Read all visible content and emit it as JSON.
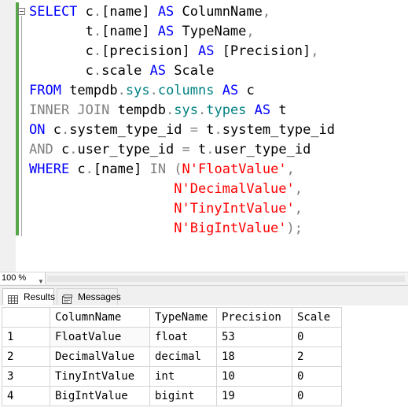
{
  "query_lines": [
    [
      {
        "t": "SELECT ",
        "c": "kw"
      },
      {
        "t": "c",
        "c": "plain"
      },
      {
        "t": ".",
        "c": "gr"
      },
      {
        "t": "[name] ",
        "c": "plain"
      },
      {
        "t": "AS ",
        "c": "kw"
      },
      {
        "t": "ColumnName",
        "c": "plain"
      },
      {
        "t": ",",
        "c": "gr"
      }
    ],
    [
      {
        "t": "       t",
        "c": "plain"
      },
      {
        "t": ".",
        "c": "gr"
      },
      {
        "t": "[name] ",
        "c": "plain"
      },
      {
        "t": "AS ",
        "c": "kw"
      },
      {
        "t": "TypeName",
        "c": "plain"
      },
      {
        "t": ",",
        "c": "gr"
      }
    ],
    [
      {
        "t": "       c",
        "c": "plain"
      },
      {
        "t": ".",
        "c": "gr"
      },
      {
        "t": "[precision] ",
        "c": "plain"
      },
      {
        "t": "AS ",
        "c": "kw"
      },
      {
        "t": "[Precision]",
        "c": "plain"
      },
      {
        "t": ",",
        "c": "gr"
      }
    ],
    [
      {
        "t": "       c",
        "c": "plain"
      },
      {
        "t": ".",
        "c": "gr"
      },
      {
        "t": "scale ",
        "c": "plain"
      },
      {
        "t": "AS ",
        "c": "kw"
      },
      {
        "t": "Scale",
        "c": "plain"
      }
    ],
    [
      {
        "t": "FROM ",
        "c": "kw"
      },
      {
        "t": "tempdb",
        "c": "plain"
      },
      {
        "t": ".",
        "c": "gr"
      },
      {
        "t": "sys",
        "c": "fn"
      },
      {
        "t": ".",
        "c": "gr"
      },
      {
        "t": "columns ",
        "c": "fn"
      },
      {
        "t": "AS ",
        "c": "kw"
      },
      {
        "t": "c",
        "c": "plain"
      }
    ],
    [
      {
        "t": "INNER JOIN ",
        "c": "gr"
      },
      {
        "t": "tempdb",
        "c": "plain"
      },
      {
        "t": ".",
        "c": "gr"
      },
      {
        "t": "sys",
        "c": "fn"
      },
      {
        "t": ".",
        "c": "gr"
      },
      {
        "t": "types ",
        "c": "fn"
      },
      {
        "t": "AS ",
        "c": "kw"
      },
      {
        "t": "t",
        "c": "plain"
      }
    ],
    [
      {
        "t": "ON ",
        "c": "kw"
      },
      {
        "t": "c",
        "c": "plain"
      },
      {
        "t": ".",
        "c": "gr"
      },
      {
        "t": "system_type_id ",
        "c": "plain"
      },
      {
        "t": "= ",
        "c": "gr"
      },
      {
        "t": "t",
        "c": "plain"
      },
      {
        "t": ".",
        "c": "gr"
      },
      {
        "t": "system_type_id",
        "c": "plain"
      }
    ],
    [
      {
        "t": "AND ",
        "c": "gr"
      },
      {
        "t": "c",
        "c": "plain"
      },
      {
        "t": ".",
        "c": "gr"
      },
      {
        "t": "user_type_id ",
        "c": "plain"
      },
      {
        "t": "= ",
        "c": "gr"
      },
      {
        "t": "t",
        "c": "plain"
      },
      {
        "t": ".",
        "c": "gr"
      },
      {
        "t": "user_type_id",
        "c": "plain"
      }
    ],
    [
      {
        "t": "WHERE ",
        "c": "kw"
      },
      {
        "t": "c",
        "c": "plain"
      },
      {
        "t": ".",
        "c": "gr"
      },
      {
        "t": "[name] ",
        "c": "plain"
      },
      {
        "t": "IN ",
        "c": "gr"
      },
      {
        "t": "(",
        "c": "gr"
      },
      {
        "t": "N'FloatValue'",
        "c": "str"
      },
      {
        "t": ",",
        "c": "gr"
      }
    ],
    [
      {
        "t": "                  ",
        "c": "plain"
      },
      {
        "t": "N'DecimalValue'",
        "c": "str"
      },
      {
        "t": ",",
        "c": "gr"
      }
    ],
    [
      {
        "t": "                  ",
        "c": "plain"
      },
      {
        "t": "N'TinyIntValue'",
        "c": "str"
      },
      {
        "t": ",",
        "c": "gr"
      }
    ],
    [
      {
        "t": "                  ",
        "c": "plain"
      },
      {
        "t": "N'BigIntValue'",
        "c": "str"
      },
      {
        "t": ");",
        "c": "gr"
      }
    ]
  ],
  "zoom": {
    "label": "100 %"
  },
  "tabs": {
    "results": "Results",
    "messages": "Messages"
  },
  "grid": {
    "headers": [
      "ColumnName",
      "TypeName",
      "Precision",
      "Scale"
    ],
    "rows": [
      {
        "num": "1",
        "cells": [
          "FloatValue",
          "float",
          "53",
          "0"
        ]
      },
      {
        "num": "2",
        "cells": [
          "DecimalValue",
          "decimal",
          "18",
          "2"
        ]
      },
      {
        "num": "3",
        "cells": [
          "TinyIntValue",
          "int",
          "10",
          "0"
        ]
      },
      {
        "num": "4",
        "cells": [
          "BigIntValue",
          "bigint",
          "19",
          "0"
        ]
      }
    ]
  },
  "colors": {
    "keyword": "#0000ff",
    "operator": "#808080",
    "system_object": "#008080",
    "string": "#ff0000"
  },
  "icons": {
    "results_tab": "grid-icon",
    "messages_tab": "messages-icon",
    "zoom_dropdown": "chevron-down-icon"
  }
}
